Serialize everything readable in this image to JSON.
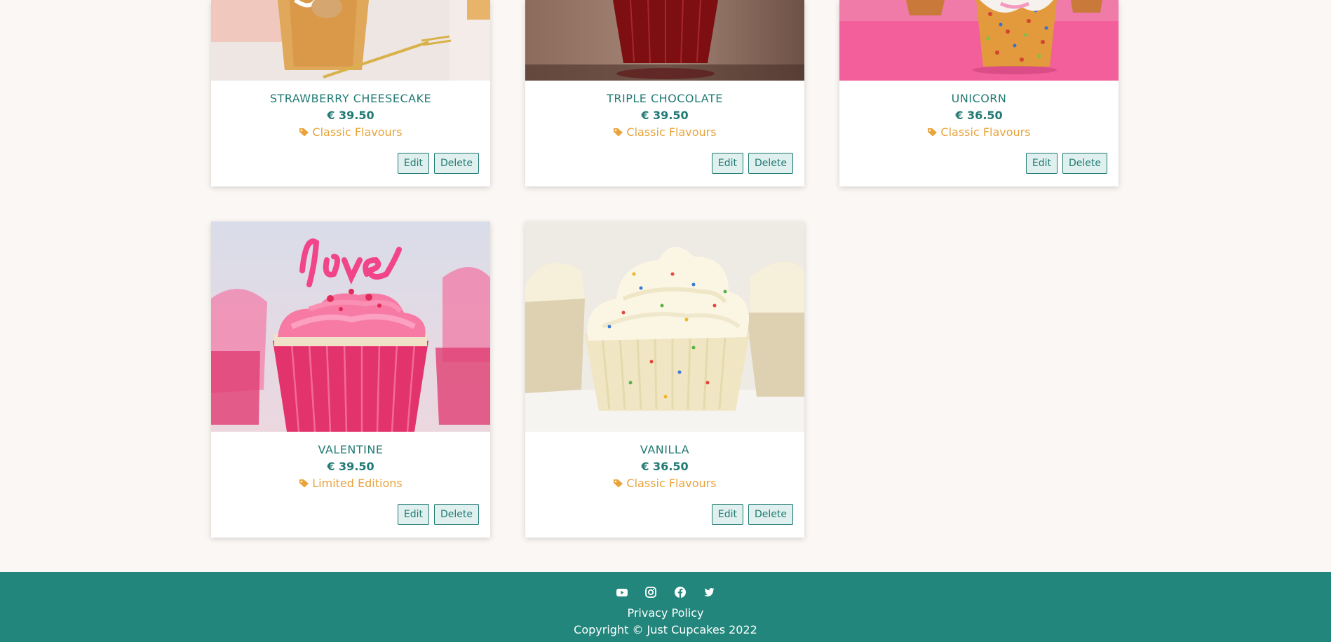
{
  "products": [
    {
      "name": "STRAWBERRY CHEESECAKE",
      "price": "€ 39.50",
      "category": "Classic Flavours",
      "edit": "Edit",
      "delete": "Delete"
    },
    {
      "name": "TRIPLE CHOCOLATE",
      "price": "€ 39.50",
      "category": "Classic Flavours",
      "edit": "Edit",
      "delete": "Delete"
    },
    {
      "name": "UNICORN",
      "price": "€ 36.50",
      "category": "Classic Flavours",
      "edit": "Edit",
      "delete": "Delete"
    },
    {
      "name": "VALENTINE",
      "price": "€ 39.50",
      "category": "Limited Editions",
      "edit": "Edit",
      "delete": "Delete"
    },
    {
      "name": "VANILLA",
      "price": "€ 36.50",
      "category": "Classic Flavours",
      "edit": "Edit",
      "delete": "Delete"
    }
  ],
  "footer": {
    "social_icons": [
      "youtube-icon",
      "instagram-icon",
      "facebook-icon",
      "twitter-icon"
    ],
    "privacy": "Privacy Policy",
    "copyright": "Copyright © Just Cupcakes 2022"
  },
  "colors": {
    "teal": "#22867c",
    "tag": "#e8a33a",
    "background": "#fbf7f4"
  }
}
